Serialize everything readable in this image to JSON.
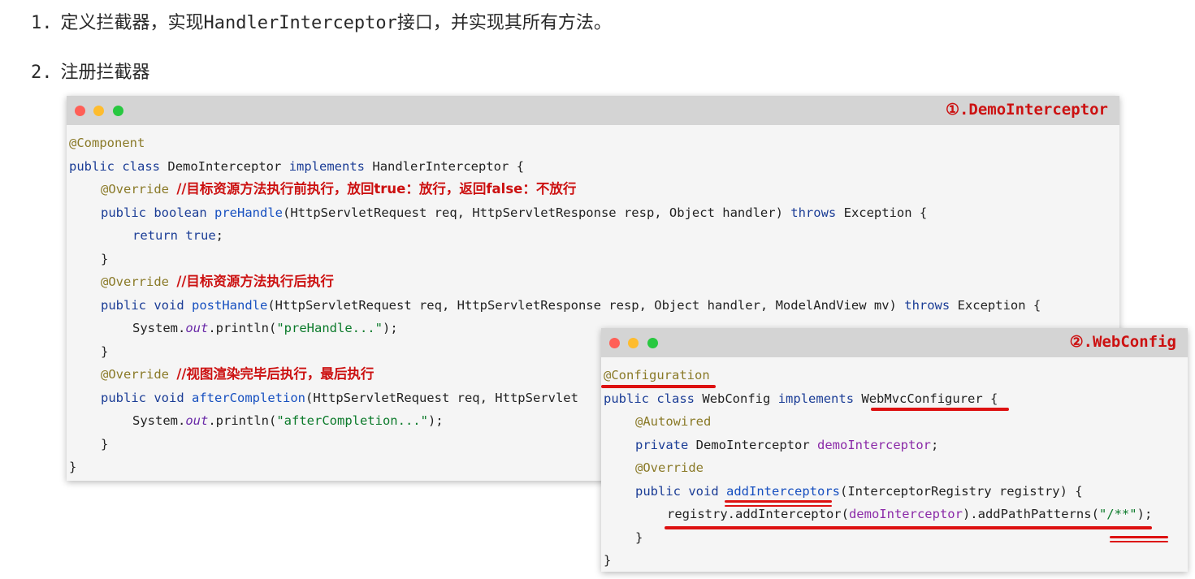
{
  "steps": [
    {
      "num": "1.",
      "text": "定义拦截器，实现HandlerInterceptor接口，并实现其所有方法。"
    },
    {
      "num": "2.",
      "text": "注册拦截器"
    }
  ],
  "window1": {
    "title": "①.DemoInterceptor",
    "code": {
      "l1_ann": "@Component",
      "l2_public": "public",
      "l2_class": "class",
      "l2_name": "DemoInterceptor",
      "l2_impl": "implements",
      "l2_iface": "HandlerInterceptor",
      "l2_brace": "{",
      "l3_ann": "@Override",
      "l3_cmt": "//目标资源方法执行前执行，放回true：放行，返回false：不放行",
      "l4_public": "public",
      "l4_type": "boolean",
      "l4_fn": "preHandle",
      "l4_params": "(HttpServletRequest req, HttpServletResponse resp, Object handler)",
      "l4_throws": "throws",
      "l4_exc": "Exception {",
      "l5_return": "return",
      "l5_true": "true",
      "l5_semi": ";",
      "l6": "}",
      "l7_ann": "@Override",
      "l7_cmt": "//目标资源方法执行后执行",
      "l8_public": "public",
      "l8_void": "void",
      "l8_fn": "postHandle",
      "l8_params": "(HttpServletRequest req, HttpServletResponse resp, Object handler, ModelAndView mv)",
      "l8_throws": "throws",
      "l8_exc": "Exception {",
      "l9_sys": "System.",
      "l9_out": "out",
      "l9_print": ".println(",
      "l9_str": "\"preHandle...\"",
      "l9_end": ");",
      "l10": "}",
      "l11_ann": "@Override",
      "l11_cmt": "//视图渲染完毕后执行，最后执行",
      "l12_public": "public",
      "l12_void": "void",
      "l12_fn": "afterCompletion",
      "l12_params": "(HttpServletRequest req, HttpServlet",
      "l13_sys": "System.",
      "l13_out": "out",
      "l13_print": ".println(",
      "l13_str": "\"afterCompletion...\"",
      "l13_end": ");",
      "l14": "}",
      "l15": "}"
    }
  },
  "window2": {
    "title": "②.WebConfig",
    "code": {
      "l1_ann": "@Configuration",
      "l2_public": "public",
      "l2_class": "class",
      "l2_name": "WebConfig",
      "l2_impl": "implements",
      "l2_iface": "WebMvcConfigurer",
      "l2_brace": "{",
      "l3_ann": "@Autowired",
      "l4_private": "private",
      "l4_type": "DemoInterceptor",
      "l4_field": "demoInterceptor",
      "l4_semi": ";",
      "l5_ann": "@Override",
      "l6_public": "public",
      "l6_void": "void",
      "l6_fn": "addInterceptors",
      "l6_params": "(InterceptorRegistry registry) {",
      "l7_call": "registry.addInterceptor(",
      "l7_field": "demoInterceptor",
      "l7_mid": ").addPathPatterns(",
      "l7_str": "\"/**\"",
      "l7_end": ");",
      "l8": "}",
      "l9": "}"
    }
  },
  "colors": {
    "highlight": "#dd1111",
    "keyword": "#1b3d96",
    "annotation": "#8a7a28",
    "string": "#0b7a2a"
  }
}
